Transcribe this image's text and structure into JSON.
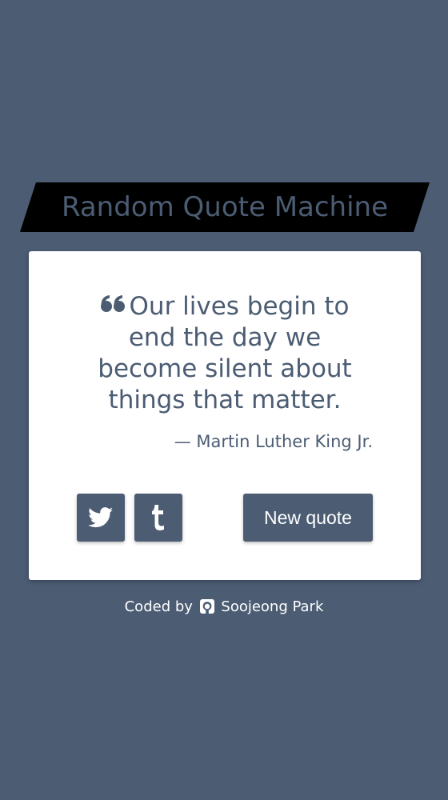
{
  "header": {
    "title": "Random Quote Machine"
  },
  "quote": {
    "icon": "quote-left-icon",
    "text": "Our lives begin to end the day we become silent about things that matter.",
    "author": "— Martin Luther King Jr."
  },
  "actions": {
    "twitter_icon": "twitter-icon",
    "tumblr_icon": "tumblr-icon",
    "new_quote_label": "New quote"
  },
  "footer": {
    "prefix": "Coded by",
    "icon": "github-icon",
    "author": "Soojeong Park"
  },
  "colors": {
    "background": "#4b5c73",
    "banner": "#000000",
    "card": "#ffffff",
    "text": "#ffffff"
  }
}
